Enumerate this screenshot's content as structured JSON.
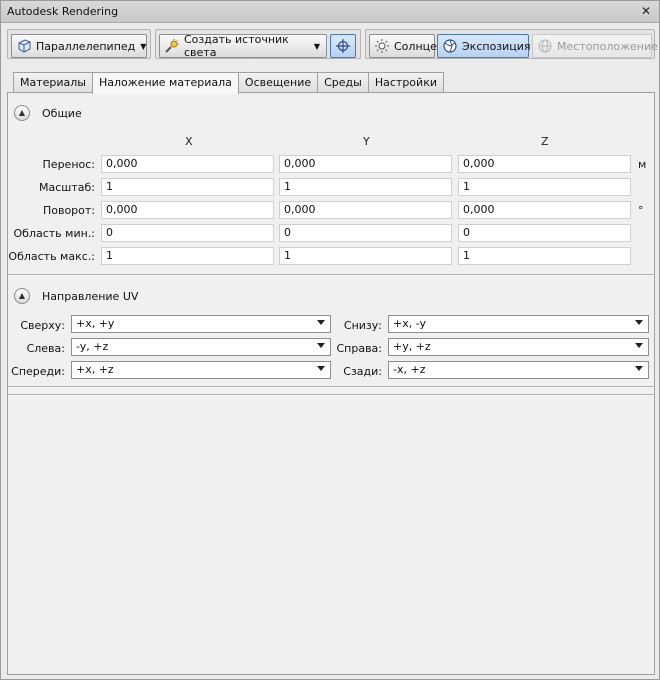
{
  "window": {
    "title": "Autodesk Rendering",
    "close_glyph": "✕"
  },
  "toolbar": {
    "mapping_button": {
      "label": "Параллелепипед",
      "icon": "box-mapping-icon"
    },
    "create_light_button": {
      "label": "Создать источник света",
      "icon": "light-icon"
    },
    "light_target_icon": "crosshair-icon",
    "sun_button": {
      "label": "Солнце",
      "icon": "sun-icon"
    },
    "exposure_button": {
      "label": "Экспозиция",
      "icon": "exposure-icon"
    },
    "location_button": {
      "label": "Местоположение",
      "icon": "globe-icon"
    }
  },
  "tabs": [
    {
      "label": "Материалы"
    },
    {
      "label": "Наложение материала"
    },
    {
      "label": "Освещение"
    },
    {
      "label": "Среды"
    },
    {
      "label": "Настройки"
    }
  ],
  "general": {
    "title": "Общие",
    "columns": [
      "X",
      "Y",
      "Z"
    ],
    "rows": [
      {
        "label": "Перенос:",
        "values": [
          "0,000",
          "0,000",
          "0,000"
        ],
        "unit": "м"
      },
      {
        "label": "Масштаб:",
        "values": [
          "1",
          "1",
          "1"
        ],
        "unit": ""
      },
      {
        "label": "Поворот:",
        "values": [
          "0,000",
          "0,000",
          "0,000"
        ],
        "unit": "°"
      },
      {
        "label": "Область мин.:",
        "values": [
          "0",
          "0",
          "0"
        ],
        "unit": ""
      },
      {
        "label": "Область макс.:",
        "values": [
          "1",
          "1",
          "1"
        ],
        "unit": ""
      }
    ]
  },
  "uv": {
    "title": "Направление UV",
    "left": [
      {
        "label": "Сверху:",
        "value": "+x, +y"
      },
      {
        "label": "Слева:",
        "value": "-y, +z"
      },
      {
        "label": "Спереди:",
        "value": "+x, +z"
      }
    ],
    "right": [
      {
        "label": "Снизу:",
        "value": "+x, -y"
      },
      {
        "label": "Справа:",
        "value": "+y, +z"
      },
      {
        "label": "Сзади:",
        "value": "-x, +z"
      }
    ]
  }
}
